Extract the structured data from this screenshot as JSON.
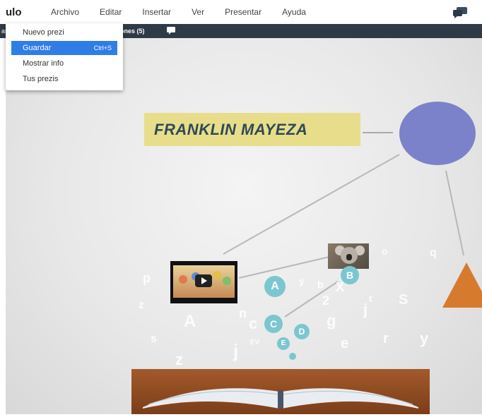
{
  "app": {
    "title": "ulo"
  },
  "menu": [
    "Archivo",
    "Editar",
    "Insertar",
    "Ver",
    "Presentar",
    "Ayuda"
  ],
  "toolbar": {
    "left_fragment": "as",
    "center_text": "ones (5)"
  },
  "dropdown": {
    "items": [
      {
        "label": "Nuevo prezi",
        "shortcut": ""
      },
      {
        "label": "Guardar",
        "shortcut": "Ctrl+S"
      },
      {
        "label": "Mostrar info",
        "shortcut": ""
      },
      {
        "label": "Tus prezis",
        "shortcut": ""
      }
    ],
    "selected_index": 1
  },
  "canvas": {
    "title": "FRANKLIN MAYEZA",
    "bubbles": [
      "A",
      "B",
      "C",
      "D",
      "E"
    ]
  },
  "colors": {
    "accent": "#2f7ee8",
    "toolbar": "#2f3a47",
    "title_box": "#e8dd8a",
    "title_text": "#2f4a55",
    "circle": "#7b82c9",
    "triangle": "#d67a2e",
    "bubble": "#7cc6d0"
  },
  "icons": [
    "chat-bubbles-icon",
    "comment-icon",
    "play-icon"
  ]
}
